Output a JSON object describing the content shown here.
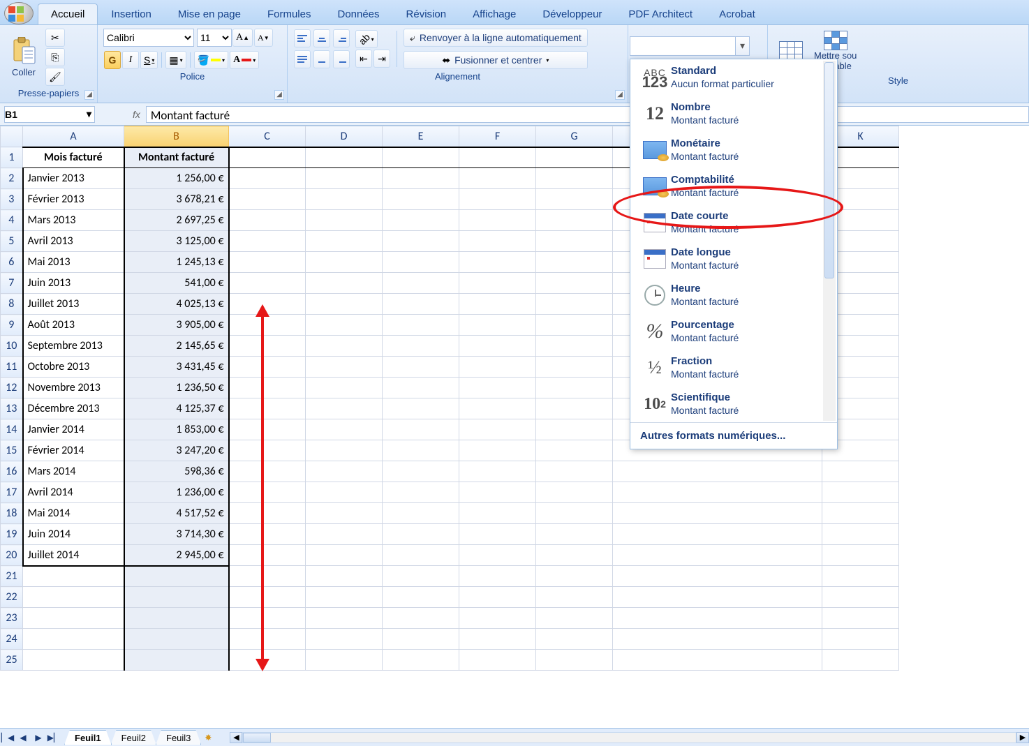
{
  "tabs": [
    "Accueil",
    "Insertion",
    "Mise en page",
    "Formules",
    "Données",
    "Révision",
    "Affichage",
    "Développeur",
    "PDF Architect",
    "Acrobat"
  ],
  "active_tab": "Accueil",
  "clipboard": {
    "paste": "Coller",
    "group": "Presse-papiers"
  },
  "font": {
    "family": "Calibri",
    "size": "11",
    "group": "Police",
    "bold": "G",
    "italic": "I",
    "underline": "S"
  },
  "alignment": {
    "wrap": "Renvoyer à la ligne automatiquement",
    "merge": "Fusionner et centrer",
    "group": "Alignement"
  },
  "styles": {
    "format_table": "Mettre sous forme de tableau",
    "line1": "Mettre sou",
    "line2": "de table",
    "group": "Style"
  },
  "formula": {
    "cell": "B1",
    "value": "Montant facturé"
  },
  "columns": [
    "A",
    "B",
    "C",
    "D",
    "E",
    "F",
    "G",
    "K"
  ],
  "headers": {
    "mois": "Mois facturé",
    "montant": "Montant facturé"
  },
  "rows": [
    {
      "mois": "Janvier 2013",
      "montant": "1 256,00 €"
    },
    {
      "mois": "Février 2013",
      "montant": "3 678,21 €"
    },
    {
      "mois": "Mars 2013",
      "montant": "2 697,25 €"
    },
    {
      "mois": "Avril 2013",
      "montant": "3 125,00 €"
    },
    {
      "mois": "Mai 2013",
      "montant": "1 245,13 €"
    },
    {
      "mois": "Juin 2013",
      "montant": "541,00 €"
    },
    {
      "mois": "Juillet 2013",
      "montant": "4 025,13 €"
    },
    {
      "mois": "Août 2013",
      "montant": "3 905,00 €"
    },
    {
      "mois": "Septembre 2013",
      "montant": "2 145,65 €"
    },
    {
      "mois": "Octobre 2013",
      "montant": "3 431,45 €"
    },
    {
      "mois": "Novembre 2013",
      "montant": "1 236,50 €"
    },
    {
      "mois": "Décembre 2013",
      "montant": "4 125,37 €"
    },
    {
      "mois": "Janvier 2014",
      "montant": "1 853,00 €"
    },
    {
      "mois": "Février 2014",
      "montant": "3 247,20 €"
    },
    {
      "mois": "Mars 2014",
      "montant": "598,36 €"
    },
    {
      "mois": "Avril 2014",
      "montant": "1 236,00 €"
    },
    {
      "mois": "Mai 2014",
      "montant": "4 517,52 €"
    },
    {
      "mois": "Juin 2014",
      "montant": "3 714,30 €"
    },
    {
      "mois": "Juillet 2014",
      "montant": "2 945,00 €"
    }
  ],
  "empty_rows": [
    21,
    22,
    23,
    24,
    25
  ],
  "format_menu": {
    "items": [
      {
        "title": "Standard",
        "sub": "Aucun format particulier",
        "icon": "abc"
      },
      {
        "title": "Nombre",
        "sub": "Montant facturé",
        "icon": "num"
      },
      {
        "title": "Monétaire",
        "sub": "Montant facturé",
        "icon": "money"
      },
      {
        "title": "Comptabilité",
        "sub": "Montant facturé",
        "icon": "money"
      },
      {
        "title": "Date courte",
        "sub": "Montant facturé",
        "icon": "cal"
      },
      {
        "title": "Date longue",
        "sub": "Montant facturé",
        "icon": "cal"
      },
      {
        "title": "Heure",
        "sub": "Montant facturé",
        "icon": "clock"
      },
      {
        "title": "Pourcentage",
        "sub": "Montant facturé",
        "icon": "pct"
      },
      {
        "title": "Fraction",
        "sub": "Montant facturé",
        "icon": "frac"
      },
      {
        "title": "Scientifique",
        "sub": "Montant facturé",
        "icon": "sci"
      }
    ],
    "footer": "Autres formats numériques..."
  },
  "sheets": {
    "tabs": [
      "Feuil1",
      "Feuil2",
      "Feuil3"
    ],
    "active": "Feuil1"
  }
}
